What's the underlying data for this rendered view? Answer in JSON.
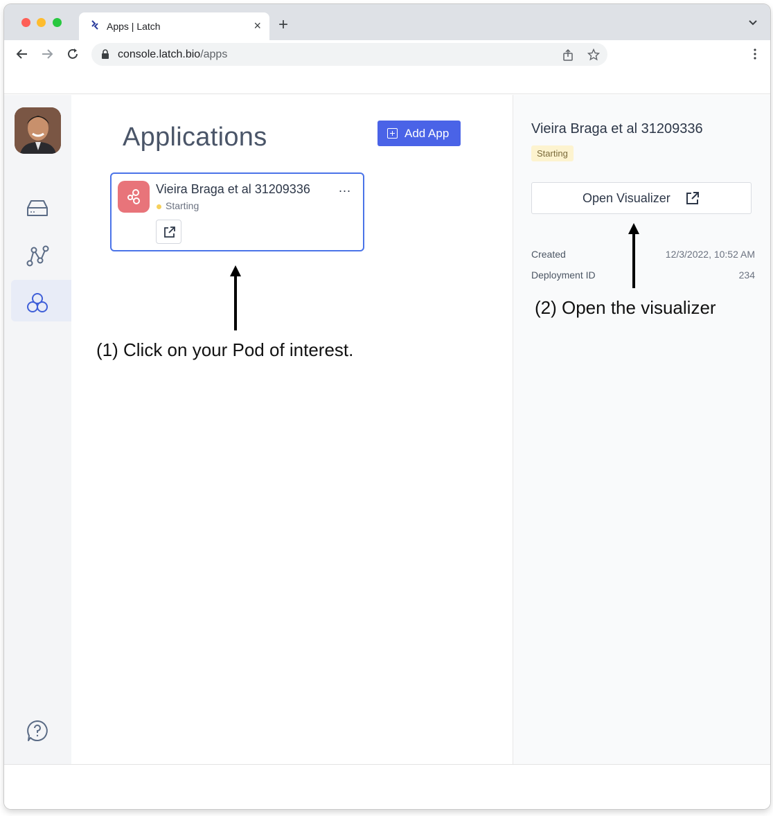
{
  "browser": {
    "tab_title": "Apps | Latch",
    "url_host": "console.latch.bio",
    "url_path": "/apps",
    "new_tab_label": "+",
    "close_tab_label": "×"
  },
  "main": {
    "title": "Applications",
    "add_app_label": "Add App"
  },
  "card": {
    "title": "Vieira Braga et al 31209336",
    "status": "Starting",
    "more_label": "..."
  },
  "detail": {
    "title": "Vieira Braga et al 31209336",
    "status_badge": "Starting",
    "open_visualizer_label": "Open Visualizer",
    "created_label": "Created",
    "created_value": "12/3/2022, 10:52 AM",
    "deployment_id_label": "Deployment ID",
    "deployment_id_value": "234"
  },
  "annotations": {
    "step1": "(1) Click on your Pod of interest.",
    "step2": "(2) Open the visualizer"
  },
  "colors": {
    "accent": "#4a63e7",
    "card_border": "#4a73e8",
    "card_icon_bg": "#e8747a",
    "status_dot": "#f6d05b",
    "badge_bg": "#fdf3cf"
  },
  "icons": {
    "sidebar": [
      "drive-icon",
      "graph-icon",
      "apps-hexagon-icon",
      "help-icon"
    ],
    "card": [
      "pod-icon",
      "external-link-icon"
    ],
    "browser": [
      "back-icon",
      "forward-icon",
      "reload-icon",
      "lock-icon",
      "share-icon",
      "star-icon",
      "menu-icon"
    ]
  }
}
